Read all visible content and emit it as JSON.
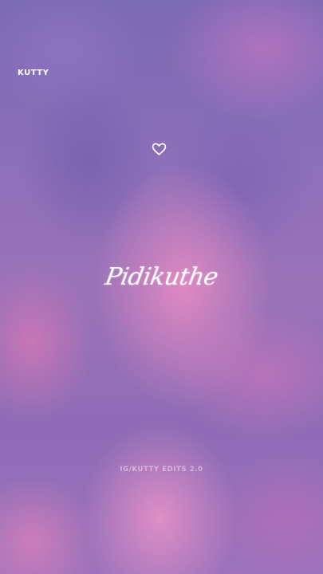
{
  "overlay": {
    "brand": "KUTTY",
    "heart_icon": "heart-outline-icon",
    "lyric": "Pidikuthe",
    "watermark": "IG/KUTTY EDITS 2.0"
  },
  "colors": {
    "text": "#ffffff",
    "sky_pink": "#eb8cc3",
    "sky_purple": "#7b6ab4"
  }
}
